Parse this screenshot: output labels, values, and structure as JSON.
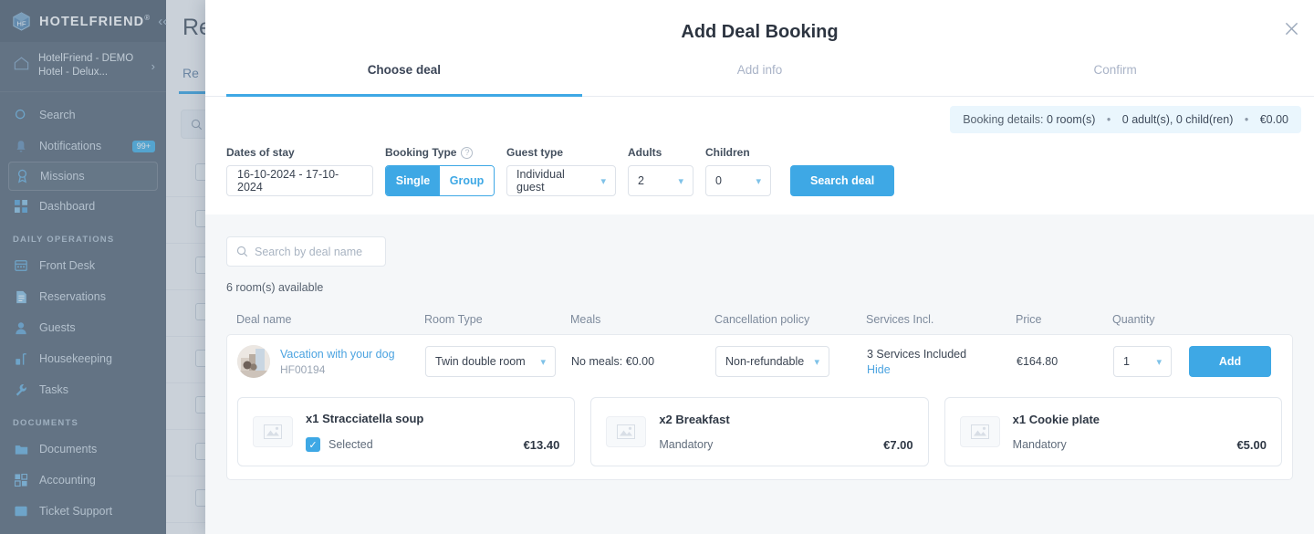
{
  "sidebar": {
    "brand": {
      "name": "HOTELFRIEND",
      "reg": "®",
      "collapse_icon": "chevron-left-icon"
    },
    "hotel": {
      "name": "HotelFriend - DEMO Hotel - Delux..."
    },
    "items": [
      {
        "label": "Search",
        "icon": "search-icon"
      },
      {
        "label": "Notifications",
        "icon": "bell-icon",
        "badge": "99+"
      },
      {
        "label": "Missions",
        "icon": "medal-icon",
        "highlight": true
      },
      {
        "label": "Dashboard",
        "icon": "grid-icon"
      }
    ],
    "section_daily": "DAILY OPERATIONS",
    "daily_items": [
      {
        "label": "Front Desk",
        "icon": "desk-icon"
      },
      {
        "label": "Reservations",
        "icon": "document-icon"
      },
      {
        "label": "Guests",
        "icon": "person-icon"
      },
      {
        "label": "Housekeeping",
        "icon": "cleaning-icon"
      },
      {
        "label": "Tasks",
        "icon": "wrench-icon"
      }
    ],
    "section_documents": "DOCUMENTS",
    "document_items": [
      {
        "label": "Documents",
        "icon": "folder-icon"
      },
      {
        "label": "Accounting",
        "icon": "calculator-icon"
      },
      {
        "label": "Ticket Support",
        "icon": "ticket-icon"
      }
    ]
  },
  "background": {
    "page_title": "Res",
    "tab_label": "Re",
    "search_placeholder": ""
  },
  "modal": {
    "title": "Add Deal Booking",
    "close_icon": "close-icon",
    "tabs": [
      {
        "label": "Choose deal",
        "active": true
      },
      {
        "label": "Add info",
        "active": false
      },
      {
        "label": "Confirm",
        "active": false
      }
    ],
    "booking_details": {
      "label": "Booking details:",
      "rooms": "0 room(s)",
      "guests": "0 adult(s), 0 child(ren)",
      "total": "€0.00",
      "separator": "•"
    },
    "search_form": {
      "dates_label": "Dates of stay",
      "dates_value": "16-10-2024 - 17-10-2024",
      "booking_type_label": "Booking Type",
      "booking_type_help_icon": "question-icon",
      "booking_type_single": "Single",
      "booking_type_group": "Group",
      "guest_type_label": "Guest type",
      "guest_type_value": "Individual guest",
      "adults_label": "Adults",
      "adults_value": "2",
      "children_label": "Children",
      "children_value": "0",
      "search_button": "Search deal"
    },
    "results": {
      "deal_search_placeholder": "Search by deal name",
      "search_icon": "search-icon",
      "availability": "6 room(s) available",
      "columns": [
        "Deal name",
        "Room Type",
        "Meals",
        "Cancellation policy",
        "Services Incl.",
        "Price",
        "Quantity"
      ],
      "deal": {
        "thumbnail_icon": "dog-photo-thumbnail",
        "name": "Vacation with your dog",
        "code": "HF00194",
        "room_type": "Twin double room",
        "meals": "No meals: €0.00",
        "cancellation_policy": "Non-refundable",
        "services_included": "3 Services Included",
        "services_toggle": "Hide",
        "price": "€164.80",
        "quantity": "1",
        "add_button": "Add"
      },
      "services": [
        {
          "title": "x1 Stracciatella soup",
          "state": "Selected",
          "price": "€13.40",
          "selected": true,
          "image_icon": "image-placeholder-icon"
        },
        {
          "title": "x2 Breakfast",
          "state": "Mandatory",
          "price": "€7.00",
          "selected": false,
          "image_icon": "image-placeholder-icon"
        },
        {
          "title": "x1 Cookie plate",
          "state": "Mandatory",
          "price": "€5.00",
          "selected": false,
          "image_icon": "image-placeholder-icon"
        }
      ]
    }
  },
  "colors": {
    "accent": "#3ea8e5",
    "sidebar_bg": "#5f6e7d",
    "link": "#4ba3e0",
    "pill_bg": "#eaf6fd"
  }
}
